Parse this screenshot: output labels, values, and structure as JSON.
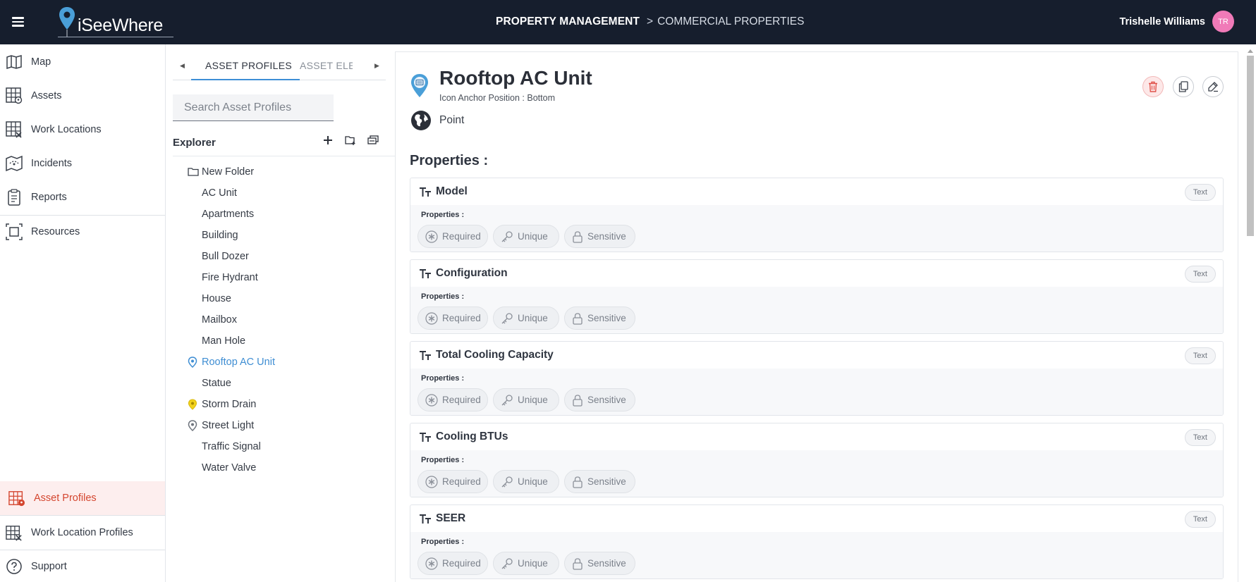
{
  "header": {
    "brand": "iSeeWhere",
    "breadcrumb_primary": "PROPERTY MANAGEMENT",
    "breadcrumb_separator": ">",
    "breadcrumb_secondary": "COMMERCIAL PROPERTIES",
    "user_name": "Trishelle Williams",
    "user_initials": "TR"
  },
  "sidebar": {
    "top_items": [
      {
        "label": "Map",
        "icon": "map-icon"
      },
      {
        "label": "Assets",
        "icon": "assets-grid-icon"
      },
      {
        "label": "Work Locations",
        "icon": "work-locations-icon"
      },
      {
        "label": "Incidents",
        "icon": "incidents-icon"
      },
      {
        "label": "Reports",
        "icon": "clipboard-icon"
      },
      {
        "label": "Resources",
        "icon": "resources-icon"
      }
    ],
    "bottom_items": [
      {
        "label": "Asset Profiles",
        "icon": "asset-profiles-icon",
        "active": true
      },
      {
        "label": "Work Location Profiles",
        "icon": "work-location-profiles-icon"
      },
      {
        "label": "Support",
        "icon": "help-circle-icon"
      }
    ]
  },
  "explorer": {
    "tabs": [
      "ASSET PROFILES",
      "ASSET ELEI"
    ],
    "search_placeholder": "Search Asset Profiles",
    "title": "Explorer",
    "folder": "New Folder",
    "items": [
      {
        "label": "AC Unit",
        "icon": ""
      },
      {
        "label": "Apartments",
        "icon": ""
      },
      {
        "label": "Building",
        "icon": ""
      },
      {
        "label": "Bull Dozer",
        "icon": ""
      },
      {
        "label": "Fire Hydrant",
        "icon": ""
      },
      {
        "label": "House",
        "icon": ""
      },
      {
        "label": "Mailbox",
        "icon": ""
      },
      {
        "label": "Man Hole",
        "icon": ""
      },
      {
        "label": "Rooftop AC Unit",
        "icon": "blue-pin-icon",
        "selected": true
      },
      {
        "label": "Statue",
        "icon": ""
      },
      {
        "label": "Storm Drain",
        "icon": "yellow-pin-icon"
      },
      {
        "label": "Street Light",
        "icon": "gray-pin-icon"
      },
      {
        "label": "Traffic Signal",
        "icon": ""
      },
      {
        "label": "Water Valve",
        "icon": ""
      }
    ]
  },
  "asset": {
    "title": "Rooftop AC Unit",
    "anchor": "Icon Anchor Position : Bottom",
    "geometry": "Point",
    "properties_heading": "Properties :",
    "property_sublabel": "Properties :",
    "flags": [
      "Required",
      "Unique",
      "Sensitive"
    ],
    "properties": [
      {
        "name": "Model",
        "type": "Text"
      },
      {
        "name": "Configuration",
        "type": "Text"
      },
      {
        "name": "Total Cooling Capacity",
        "type": "Text"
      },
      {
        "name": "Cooling BTUs",
        "type": "Text"
      },
      {
        "name": "SEER",
        "type": "Text"
      }
    ]
  },
  "colors": {
    "topbar": "#161e2d",
    "accent": "#3d8ed6",
    "active_nav": "#d4462f",
    "avatar": "#f07ab8"
  }
}
